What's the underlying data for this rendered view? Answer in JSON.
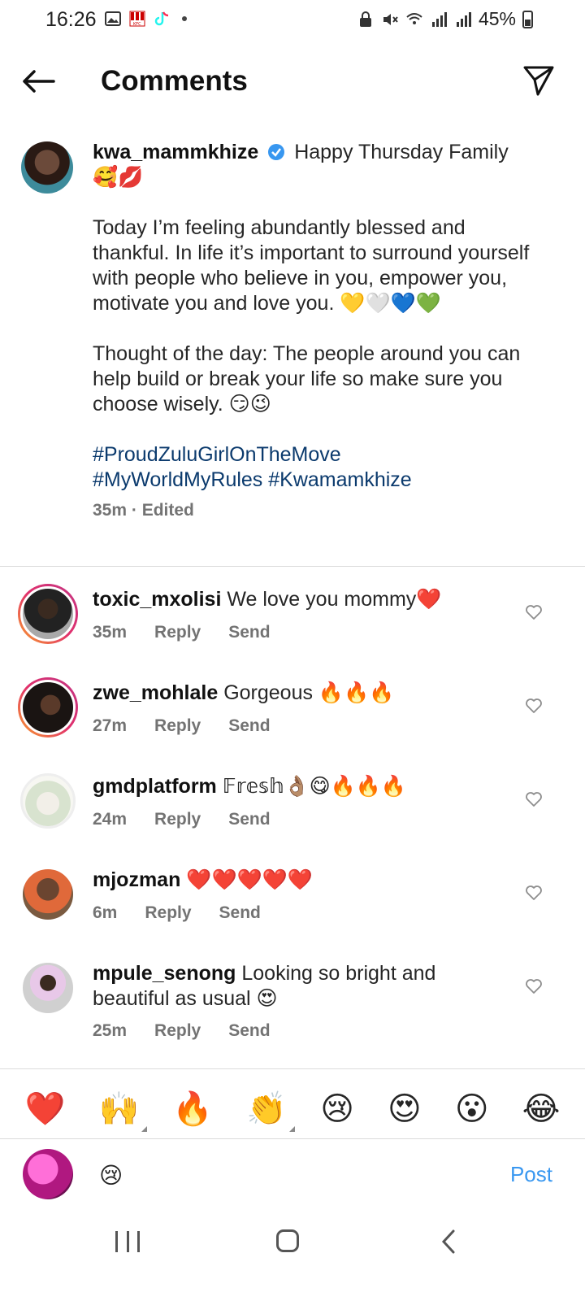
{
  "status_bar": {
    "time": "16:26",
    "battery": "45%",
    "left_icons": [
      "gallery-icon",
      "kfc-icon",
      "tiktok-icon",
      "dot-icon"
    ],
    "right_icons": [
      "lock-icon",
      "mute-icon",
      "wifi-icon",
      "signal-icon",
      "signal-icon",
      "battery-icon"
    ]
  },
  "header": {
    "title": "Comments"
  },
  "post": {
    "username": "kwa_mammkhize",
    "intro": "Happy Thursday Family 🥰💋",
    "paragraph1": "Today I’m feeling abundantly blessed and thankful. In life it’s important to surround yourself with people who believe in you, empower you, motivate you and love you. 💛🤍💙💚",
    "paragraph2": "Thought of the day: The people around you can help build or break your life so make sure you choose wisely. 😏😉",
    "hashtags": "#ProudZuluGirlOnTheMove\n#MyWorldMyRules #Kwamamkhize",
    "meta": "35m · Edited"
  },
  "comments": [
    {
      "username": "toxic_mxolisi",
      "text": "We love you mommy❤️",
      "time": "35m",
      "reply": "Reply",
      "send": "Send"
    },
    {
      "username": "zwe_mohlale",
      "text": "Gorgeous 🔥🔥🔥",
      "time": "27m",
      "reply": "Reply",
      "send": "Send"
    },
    {
      "username": "gmdplatform",
      "text": "𝔽𝕣𝕖𝕤𝕙👌🏽😋🔥🔥🔥",
      "time": "24m",
      "reply": "Reply",
      "send": "Send"
    },
    {
      "username": "mjozman",
      "text": "❤️❤️❤️❤️❤️",
      "time": "6m",
      "reply": "Reply",
      "send": "Send"
    },
    {
      "username": "mpule_senong",
      "text": "Looking so bright and beautiful as usual 😍",
      "time": "25m",
      "reply": "Reply",
      "send": "Send"
    }
  ],
  "quick_emojis": [
    "❤️",
    "🙌",
    "🔥",
    "👏",
    "😢",
    "😍",
    "😮",
    "😂"
  ],
  "compose": {
    "input_value": "😢",
    "post_label": "Post"
  }
}
